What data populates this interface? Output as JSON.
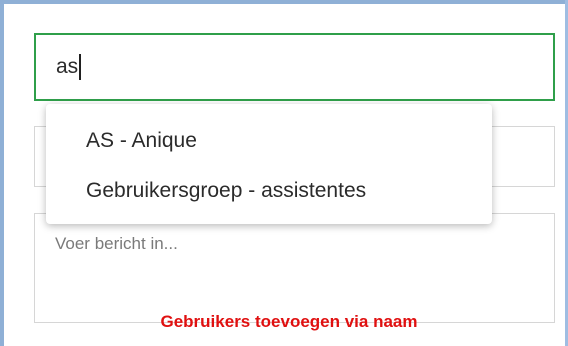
{
  "recipient": {
    "value": "as"
  },
  "autocomplete": {
    "items": [
      {
        "label": "AS - Anique"
      },
      {
        "label": "Gebruikersgroep - assistentes"
      }
    ]
  },
  "message": {
    "placeholder": "Voer bericht in..."
  },
  "caption": {
    "text": "Gebruikers toevoegen via naam"
  },
  "colors": {
    "focused_border": "#2f9f4a",
    "caption": "#e01010",
    "frame": "#8fb0d6"
  }
}
